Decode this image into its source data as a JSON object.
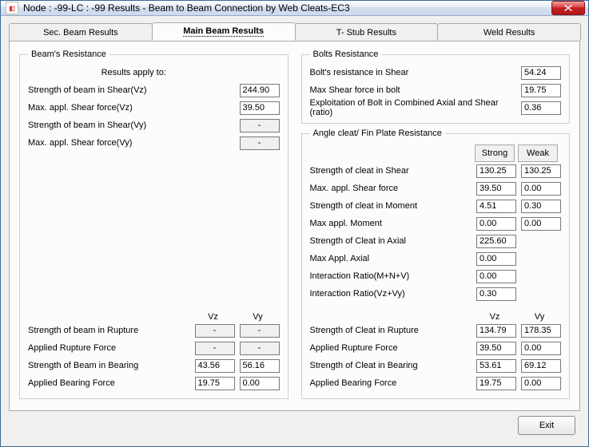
{
  "window": {
    "title": "Node : -99-LC : -99 Results - Beam to Beam Connection by Web Cleats-EC3"
  },
  "tabs": {
    "sec": "Sec. Beam Results",
    "main": "Main Beam Results",
    "tstub": "T- Stub Results",
    "weld": "Weld Results"
  },
  "beam_resistance": {
    "legend": "Beam's Resistance",
    "results_apply": "Results apply to:",
    "rows": {
      "shear_vz_lbl": "Strength of beam in Shear(Vz)",
      "shear_vz_val": "244.90",
      "max_shear_vz_lbl": "Max. appl. Shear force(Vz)",
      "max_shear_vz_val": "39.50",
      "shear_vy_lbl": "Strength of beam in Shear(Vy)",
      "shear_vy_val": "-",
      "max_shear_vy_lbl": "Max. appl. Shear force(Vy)",
      "max_shear_vy_val": "-"
    },
    "vz_vy": {
      "vz": "Vz",
      "vy": "Vy",
      "rupture_lbl": "Strength of beam in Rupture",
      "rupture_vz": "-",
      "rupture_vy": "-",
      "applied_rupture_lbl": "Applied Rupture Force",
      "applied_rupture_vz": "-",
      "applied_rupture_vy": "-",
      "bearing_lbl": "Strength of Beam in Bearing",
      "bearing_vz": "43.56",
      "bearing_vy": "56.16",
      "applied_bearing_lbl": "Applied Bearing Force",
      "applied_bearing_vz": "19.75",
      "applied_bearing_vy": "0.00"
    }
  },
  "bolts": {
    "legend": "Bolts Resistance",
    "shear_lbl": "Bolt's resistance in Shear",
    "shear_val": "54.24",
    "max_shear_lbl": "Max Shear force in bolt",
    "max_shear_val": "19.75",
    "exploit_lbl": "Exploitation of Bolt in Combined Axial and Shear (ratio)",
    "exploit_val": "0.36"
  },
  "angle": {
    "legend": "Angle cleat/ Fin Plate Resistance",
    "strong": "Strong",
    "weak": "Weak",
    "shear_lbl": "Strength of cleat in Shear",
    "shear_s": "130.25",
    "shear_w": "130.25",
    "max_shear_lbl": "Max. appl. Shear force",
    "max_shear_s": "39.50",
    "max_shear_w": "0.00",
    "moment_lbl": "Strength of cleat in Moment",
    "moment_s": "4.51",
    "moment_w": "0.30",
    "max_moment_lbl": "Max appl. Moment",
    "max_moment_s": "0.00",
    "max_moment_w": "0.00",
    "axial_lbl": "Strength of Cleat in Axial",
    "axial_val": "225.60",
    "max_axial_lbl": "Max Appl. Axial",
    "max_axial_val": "0.00",
    "inter_mnv_lbl": "Interaction Ratio(M+N+V)",
    "inter_mnv_val": "0.00",
    "inter_vzvy_lbl": "Interaction Ratio(Vz+Vy)",
    "inter_vzvy_val": "0.30",
    "vz": "Vz",
    "vy": "Vy",
    "rupture_lbl": "Strength of Cleat in Rupture",
    "rupture_vz": "134.79",
    "rupture_vy": "178.35",
    "applied_rupture_lbl": "Applied Rupture Force",
    "applied_rupture_vz": "39.50",
    "applied_rupture_vy": "0.00",
    "bearing_lbl": "Strength of Cleat in Bearing",
    "bearing_vz": "53.61",
    "bearing_vy": "69.12",
    "applied_bearing_lbl": "Applied Bearing Force",
    "applied_bearing_vz": "19.75",
    "applied_bearing_vy": "0.00"
  },
  "buttons": {
    "exit": "Exit"
  }
}
